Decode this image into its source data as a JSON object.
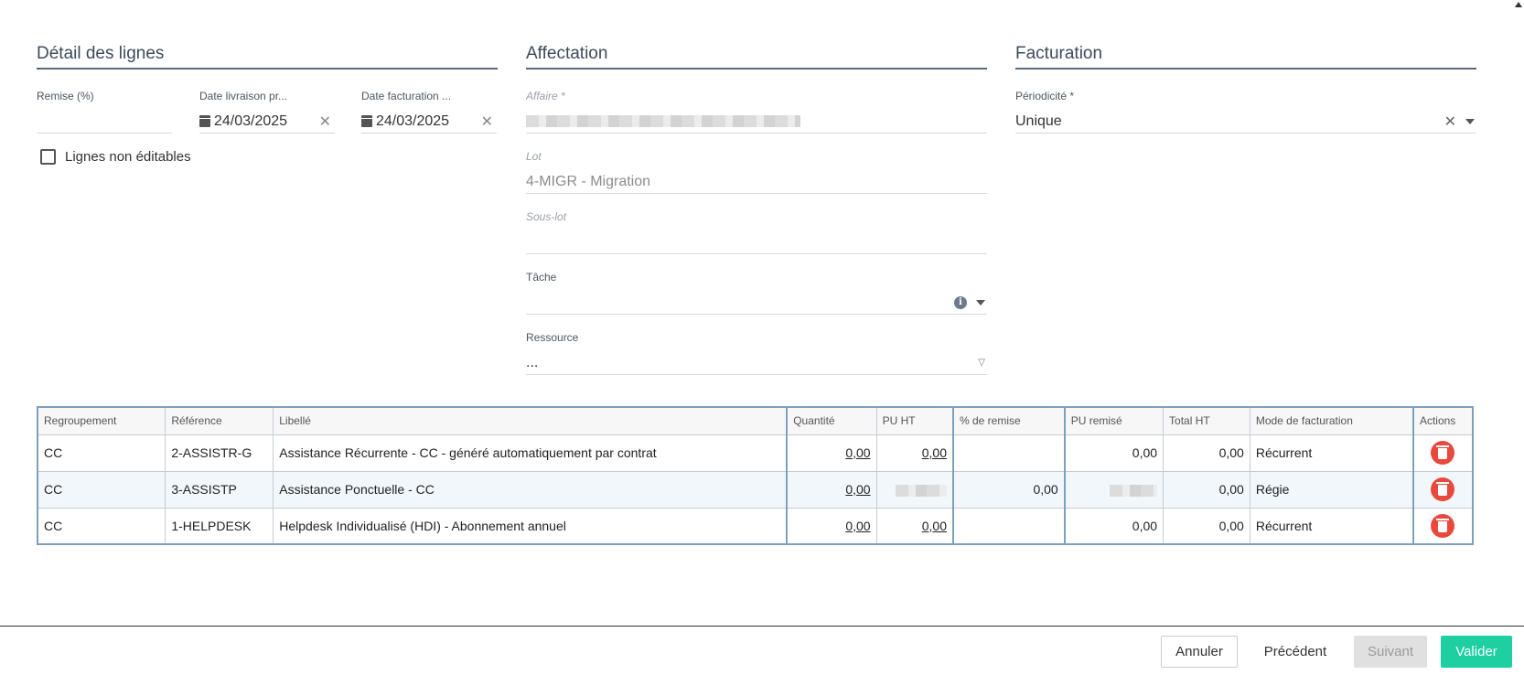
{
  "sections": {
    "lines": {
      "title": "Détail des lignes"
    },
    "assignment": {
      "title": "Affectation"
    },
    "billing": {
      "title": "Facturation"
    }
  },
  "lines_detail": {
    "discount": {
      "label": "Remise (%)",
      "value": ""
    },
    "delivery_date": {
      "label": "Date livraison pr...",
      "value": "24/03/2025"
    },
    "billing_date": {
      "label": "Date facturation ...",
      "value": "24/03/2025"
    },
    "non_editable": {
      "label": "Lignes non éditables",
      "checked": false
    }
  },
  "assignment": {
    "affaire": {
      "label": "Affaire *"
    },
    "lot": {
      "label": "Lot",
      "value": "4-MIGR - Migration"
    },
    "sous_lot": {
      "label": "Sous-lot",
      "value": ""
    },
    "tache": {
      "label": "Tâche",
      "value": ""
    },
    "ressource": {
      "label": "Ressource",
      "value": "..."
    }
  },
  "billing": {
    "periodicity": {
      "label": "Périodicité *",
      "value": "Unique"
    }
  },
  "table": {
    "headers": [
      "Regroupement",
      "Référence",
      "Libellé",
      "Quantité",
      "PU HT",
      "% de remise",
      "PU remisé",
      "Total HT",
      "Mode de facturation",
      "Actions"
    ],
    "rows": [
      {
        "group": "CC",
        "ref": "2-ASSISTR-G",
        "label": "Assistance Récurrente - CC - généré automatiquement par contrat",
        "qty": "0,00",
        "pu": "0,00",
        "discount": "",
        "pu_discounted": "0,00",
        "total": "0,00",
        "mode": "Récurrent"
      },
      {
        "group": "CC",
        "ref": "3-ASSISTP",
        "label": "Assistance Ponctuelle - CC",
        "qty": "0,00",
        "pu": "",
        "discount": "0,00",
        "pu_discounted": "",
        "total": "0,00",
        "mode": "Régie"
      },
      {
        "group": "CC",
        "ref": "1-HELPDESK",
        "label": "Helpdesk Individualisé (HDI) - Abonnement annuel",
        "qty": "0,00",
        "pu": "0,00",
        "discount": "",
        "pu_discounted": "0,00",
        "total": "0,00",
        "mode": "Récurrent"
      }
    ]
  },
  "footer": {
    "cancel": "Annuler",
    "previous": "Précédent",
    "next": "Suivant",
    "validate": "Valider"
  },
  "colors": {
    "accent": "#1dcfa1",
    "danger": "#e8493c",
    "section_border": "#5a6a7c",
    "table_border": "#7da0c0"
  }
}
